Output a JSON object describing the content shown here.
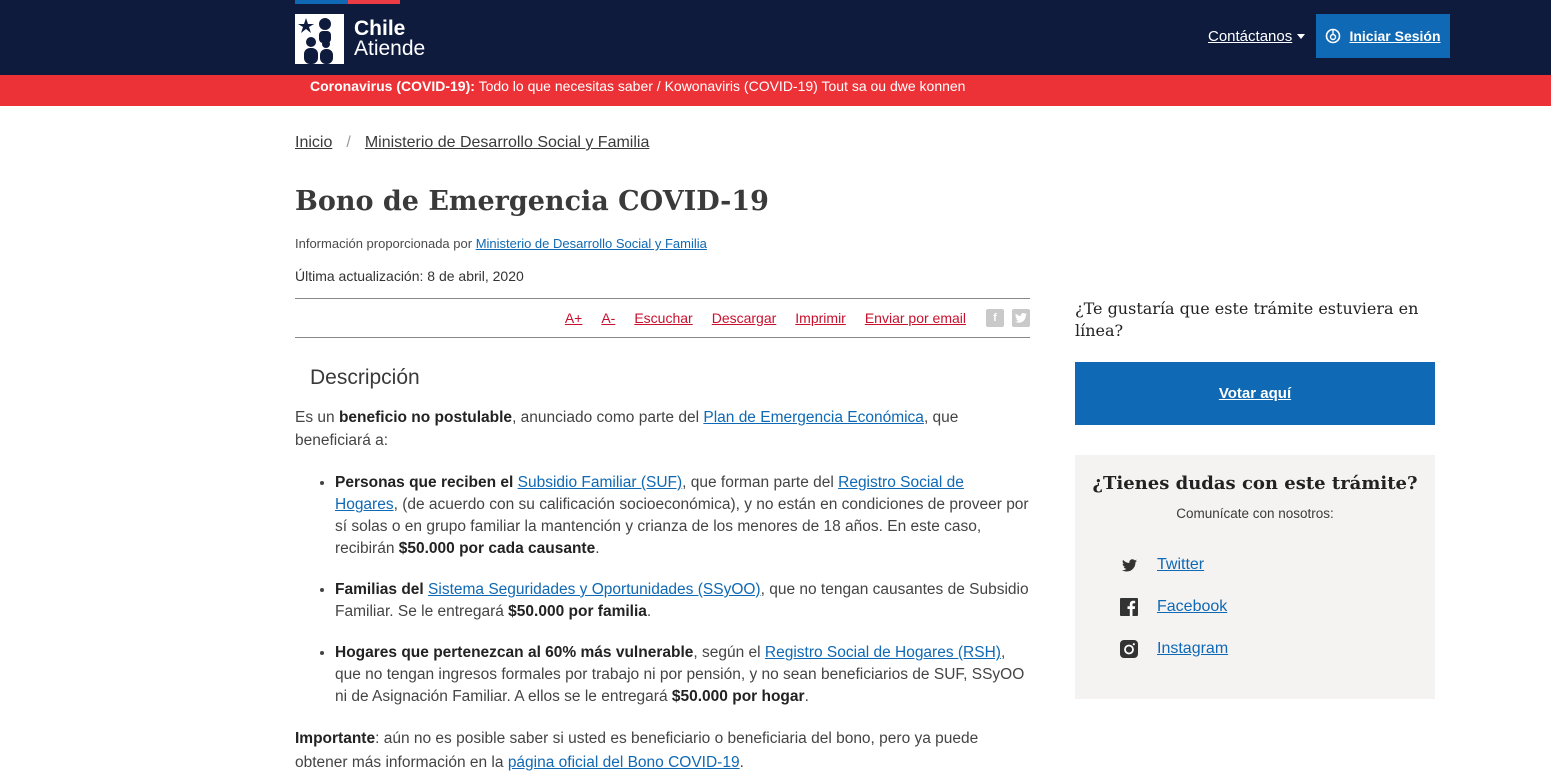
{
  "header": {
    "logo": {
      "line1": "Chile",
      "line2": "Atiende"
    },
    "contact_label": "Contáctanos",
    "login_label": "Iniciar Sesión",
    "colors": {
      "background": "#0e1b3d",
      "accent_blue": "#0f69b4",
      "accent_red": "#eb3c46"
    }
  },
  "covid_banner": {
    "bold": "Coronavirus (COVID-19):",
    "text": "Todo lo que necesitas saber / Kowonaviris (COVID-19) Tout sa ou dwe konnen",
    "color": "#ec3237"
  },
  "breadcrumb": {
    "items": [
      "Inicio",
      "Ministerio de Desarrollo Social y Familia"
    ],
    "separator": "/"
  },
  "page": {
    "title": "Bono de Emergencia COVID-19",
    "provider_prefix": "Información proporcionada por",
    "provider_link": "Ministerio de Desarrollo Social y Familia",
    "updated": "Última actualización: 8 de abril, 2020"
  },
  "toolbar": {
    "font_up": "A+",
    "font_down": "A-",
    "listen": "Escuchar",
    "download": "Descargar",
    "print": "Imprimir",
    "email": "Enviar por email",
    "share_icons": [
      "facebook-icon",
      "twitter-icon"
    ]
  },
  "content": {
    "section_title": "Descripción",
    "intro": {
      "t1": "Es un ",
      "b1": "beneficio no postulable",
      "t2": ", anunciado como parte del ",
      "link": "Plan de Emergencia Económica",
      "t3": ", que beneficiará a:"
    },
    "items": [
      {
        "b1": "Personas que reciben el ",
        "link1": "Subsidio Familiar (SUF)",
        "t1": ", que forman parte del ",
        "link2": "Registro Social de Hogares",
        "t2": ", (de acuerdo con su calificación socioeconómica), y no están en condiciones de proveer por sí solas o en grupo familiar la mantención y crianza de los menores de 18 años. En este caso, recibirán ",
        "b2": "$50.000 por cada causante",
        "t3": "."
      },
      {
        "b1": "Familias del ",
        "link1": "Sistema Seguridades y Oportunidades (SSyOO)",
        "t1": ", que no tengan causantes de Subsidio Familiar. Se le entregará ",
        "b2": "$50.000 por familia",
        "t2": "."
      },
      {
        "b1": "Hogares que pertenezcan al 60% más vulnerable",
        "t1": ", según el ",
        "link1": "Registro Social de Hogares (RSH)",
        "t2": ", que no tengan ingresos formales por trabajo ni por pensión, y no sean beneficiarios de SUF, SSyOO ni de Asignación Familiar. A ellos se le entregará ",
        "b2": "$50.000 por hogar",
        "t3": "."
      }
    ],
    "important": {
      "b": "Importante",
      "t1": ": aún no es posible saber si usted es beneficiario o beneficiaria del bono, pero ya puede obtener más información en la ",
      "link": "página oficial del Bono COVID-19",
      "t2": "."
    }
  },
  "sidebar": {
    "vote_question": "¿Te gustaría que este trámite estuviera en línea?",
    "vote_button": "Votar aquí",
    "doubts_title": "¿Tienes dudas con este trámite?",
    "doubts_sub": "Comunícate con nosotros:",
    "social": [
      {
        "label": "Twitter",
        "icon": "twitter-icon"
      },
      {
        "label": "Facebook",
        "icon": "facebook-icon"
      },
      {
        "label": "Instagram",
        "icon": "instagram-icon"
      }
    ]
  }
}
